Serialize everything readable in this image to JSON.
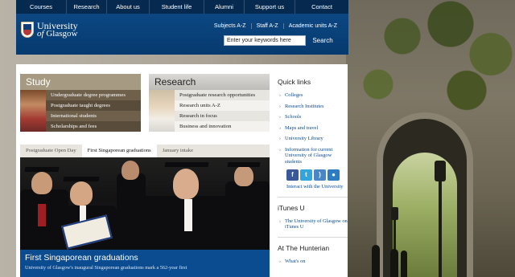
{
  "topnav": {
    "items": [
      "Courses",
      "Research",
      "About us",
      "Student life",
      "Alumni",
      "Support us",
      "Contact"
    ]
  },
  "header": {
    "logo_line1": "University",
    "logo_line2_of": "of",
    "logo_line2_name": "Glasgow",
    "links": [
      "Subjects A-Z",
      "Staff A-Z",
      "Academic units A-Z"
    ],
    "search": {
      "placeholder": "Enter your keywords here",
      "value": "Enter your keywords here",
      "button": "Search"
    }
  },
  "study": {
    "title": "Study",
    "items": [
      "Undergraduate degree programmes",
      "Postgraduate taught degrees",
      "International students",
      "Scholarships and fees"
    ]
  },
  "research": {
    "title": "Research",
    "items": [
      "Postgraduate research opportunities",
      "Research units A-Z",
      "Research in focus",
      "Business and innovation"
    ]
  },
  "feature": {
    "tabs": [
      "Postgraduate Open Day",
      "First Singaporean graduations",
      "January intake"
    ],
    "active_tab": 1,
    "title": "First Singaporean graduations",
    "subtitle": "University of Glasgow's inaugural Singaporean graduations mark a 562-year first"
  },
  "sidebar": {
    "quick_links_title": "Quick links",
    "quick_links": [
      "Colleges",
      "Research Institutes",
      "Schools",
      "Maps and travel",
      "University Library",
      "Information for current University of Glasgow students"
    ],
    "social_icons": [
      "facebook-icon",
      "twitter-icon",
      "rss-icon",
      "flickr-icon"
    ],
    "interact_label": "Interact with the University",
    "itunes_title": "iTunes U",
    "itunes_link": "The University of Glasgow on iTunes U",
    "hunterian_title": "At The Hunterian",
    "hunterian_link": "What's on"
  },
  "colors": {
    "nav_bg": "#062a4f",
    "header_bg": "#0c4782",
    "study_bg": "#6f604c",
    "caption_bg": "#0b4b8f",
    "link": "#0c4a8b"
  }
}
